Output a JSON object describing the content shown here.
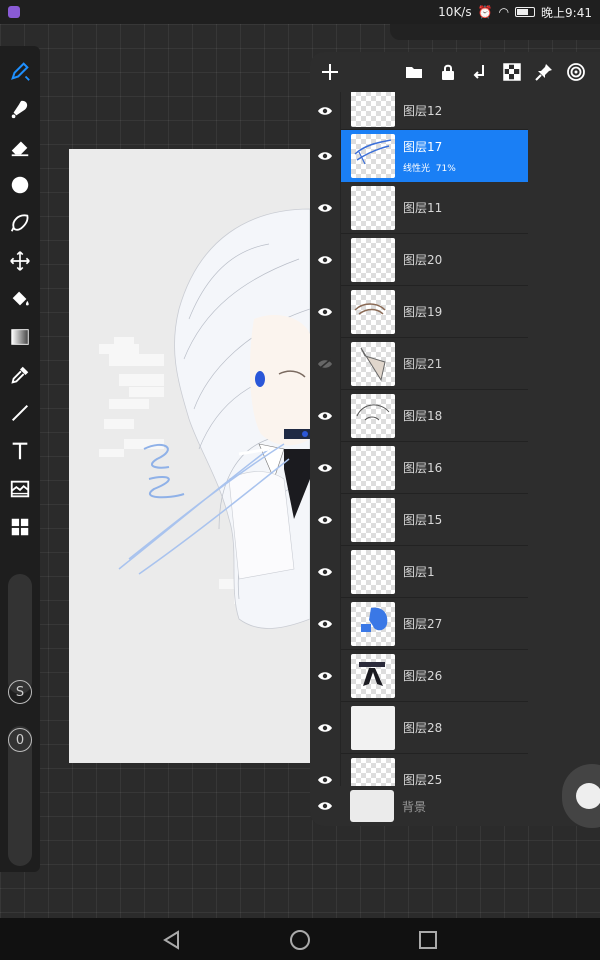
{
  "status_bar": {
    "speed": "10K/s",
    "time": "晚上9:41"
  },
  "left_toolbar": {
    "tools": [
      {
        "icon": "brush-icon",
        "active": true
      },
      {
        "icon": "smudge-icon",
        "active": false
      },
      {
        "icon": "eraser-icon",
        "active": false
      },
      {
        "icon": "circle-brush-icon",
        "active": false
      },
      {
        "icon": "lasso-icon",
        "active": false
      },
      {
        "icon": "transform-icon",
        "active": false
      },
      {
        "icon": "fill-bucket-icon",
        "active": false
      },
      {
        "icon": "gradient-icon",
        "active": false
      },
      {
        "icon": "eyedropper-icon",
        "active": false
      },
      {
        "icon": "line-icon",
        "active": false
      },
      {
        "icon": "text-icon",
        "active": false
      },
      {
        "icon": "image-adjust-icon",
        "active": false
      },
      {
        "icon": "grid-icon",
        "active": false
      }
    ],
    "size_label": "S",
    "opacity_label": "0"
  },
  "layers_panel": {
    "toolbar_icons": [
      "add-layer-icon",
      "folder-icon",
      "lock-icon",
      "merge-down-icon",
      "transparency-lock-icon",
      "pin-icon",
      "spiral-icon"
    ],
    "layers": [
      {
        "name": "图层12",
        "visible": true,
        "selected": false,
        "blend": "",
        "opacity": ""
      },
      {
        "name": "图层17",
        "visible": true,
        "selected": true,
        "blend": "线性光",
        "opacity": "71%"
      },
      {
        "name": "图层11",
        "visible": true,
        "selected": false,
        "blend": "",
        "opacity": ""
      },
      {
        "name": "图层20",
        "visible": true,
        "selected": false,
        "blend": "",
        "opacity": ""
      },
      {
        "name": "图层19",
        "visible": true,
        "selected": false,
        "blend": "",
        "opacity": ""
      },
      {
        "name": "图层21",
        "visible": false,
        "selected": false,
        "blend": "",
        "opacity": ""
      },
      {
        "name": "图层18",
        "visible": true,
        "selected": false,
        "blend": "",
        "opacity": ""
      },
      {
        "name": "图层16",
        "visible": true,
        "selected": false,
        "blend": "",
        "opacity": ""
      },
      {
        "name": "图层15",
        "visible": true,
        "selected": false,
        "blend": "",
        "opacity": ""
      },
      {
        "name": "图层1",
        "visible": true,
        "selected": false,
        "blend": "",
        "opacity": ""
      },
      {
        "name": "图层27",
        "visible": true,
        "selected": false,
        "blend": "",
        "opacity": ""
      },
      {
        "name": "图层26",
        "visible": true,
        "selected": false,
        "blend": "",
        "opacity": ""
      },
      {
        "name": "图层28",
        "visible": true,
        "selected": false,
        "blend": "",
        "opacity": ""
      },
      {
        "name": "图层25",
        "visible": true,
        "selected": false,
        "blend": "",
        "opacity": ""
      }
    ],
    "background_layer": "背景"
  },
  "colors": {
    "accent": "#1a7ff5",
    "panel": "#2d2d2d",
    "canvas": "#ebebeb"
  }
}
